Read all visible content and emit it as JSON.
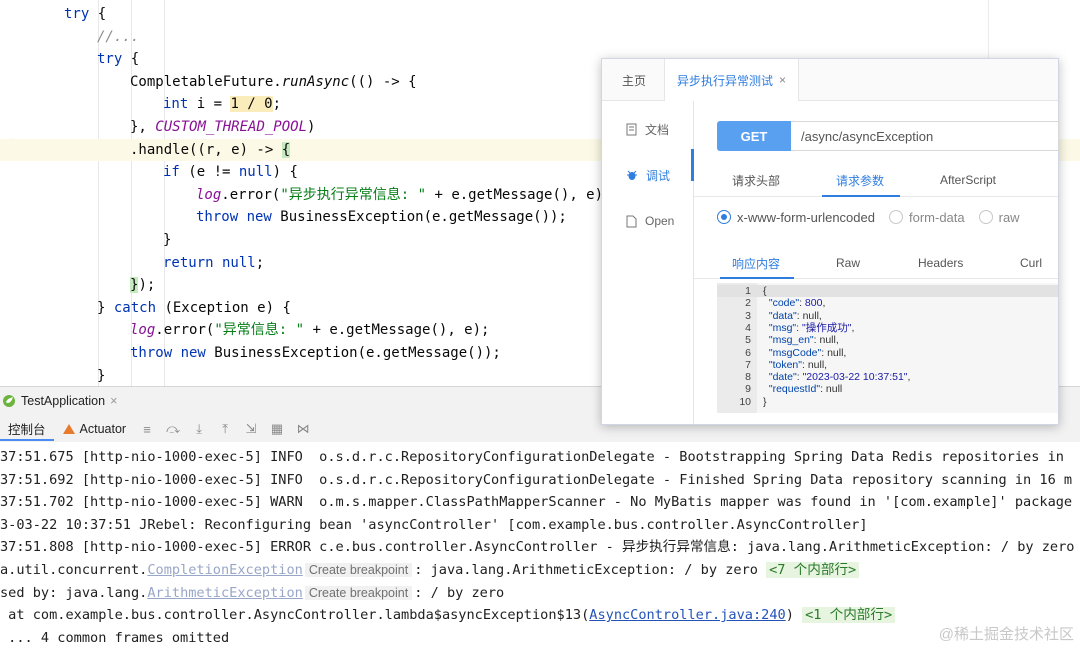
{
  "editor": {
    "lines": [
      {
        "ind": 0,
        "parts": [
          [
            "try",
            "kw"
          ],
          [
            " {",
            ""
          ]
        ]
      },
      {
        "ind": 1,
        "parts": [
          [
            "//...",
            "cm"
          ]
        ]
      },
      {
        "ind": 1,
        "parts": [
          [
            "try",
            "kw"
          ],
          [
            " {",
            ""
          ]
        ]
      },
      {
        "ind": 2,
        "parts": [
          [
            "CompletableFuture.",
            ""
          ],
          [
            "runAsync",
            "it"
          ],
          [
            "(() -> {",
            ""
          ]
        ]
      },
      {
        "ind": 3,
        "parts": [
          [
            "int",
            "kw"
          ],
          [
            " i = ",
            ""
          ],
          [
            "1 / 0",
            "bg1"
          ],
          [
            ";",
            ""
          ]
        ]
      },
      {
        "ind": 2,
        "parts": [
          [
            "}, ",
            ""
          ],
          [
            "CUSTOM_THREAD_POOL",
            "sf"
          ],
          [
            ")",
            ""
          ]
        ]
      },
      {
        "ind": 2,
        "hl": true,
        "parts": [
          [
            ".handle((r, e) -> ",
            ""
          ],
          [
            "{",
            "bbr"
          ]
        ]
      },
      {
        "ind": 3,
        "parts": [
          [
            "if",
            "kw"
          ],
          [
            " (e != ",
            ""
          ],
          [
            "null",
            "kw"
          ],
          [
            ") {",
            ""
          ]
        ]
      },
      {
        "ind": 4,
        "parts": [
          [
            "log",
            "lg"
          ],
          [
            ".error(",
            ""
          ],
          [
            "\"异步执行异常信息: \"",
            "st"
          ],
          [
            " + e.getMessage(), e);",
            ""
          ]
        ]
      },
      {
        "ind": 4,
        "parts": [
          [
            "throw new",
            "kw"
          ],
          [
            " BusinessException(e.getMessage());",
            ""
          ]
        ]
      },
      {
        "ind": 3,
        "parts": [
          [
            "}",
            ""
          ]
        ]
      },
      {
        "ind": 3,
        "parts": [
          [
            "return null",
            "kw"
          ],
          [
            ";",
            ""
          ]
        ]
      },
      {
        "ind": 2,
        "parts": [
          [
            "}",
            "bbr"
          ],
          [
            ");",
            ""
          ]
        ]
      },
      {
        "ind": 1,
        "parts": [
          [
            "} ",
            ""
          ],
          [
            "catch",
            "kw"
          ],
          [
            " (Exception e) {",
            ""
          ]
        ]
      },
      {
        "ind": 2,
        "parts": [
          [
            "log",
            "lg"
          ],
          [
            ".error(",
            ""
          ],
          [
            "\"异常信息: \"",
            "st"
          ],
          [
            " + e.getMessage(), e);",
            ""
          ]
        ]
      },
      {
        "ind": 2,
        "parts": [
          [
            "throw new",
            "kw"
          ],
          [
            " BusinessException(e.getMessage());",
            ""
          ]
        ]
      },
      {
        "ind": 1,
        "parts": [
          [
            "}",
            ""
          ]
        ]
      }
    ]
  },
  "run_tab": {
    "label": "TestApplication",
    "close": "×"
  },
  "toolbar": {
    "console_label": "控制台",
    "actuator_label": "Actuator"
  },
  "console": {
    "lines": [
      [
        [
          "37:51.675 [http-nio-1000-exec-5] INFO  o.s.d.r.c.RepositoryConfigurationDelegate - Bootstrapping Spring Data Redis repositories in",
          ""
        ]
      ],
      [
        [
          "37:51.692 [http-nio-1000-exec-5] INFO  o.s.d.r.c.RepositoryConfigurationDelegate - Finished Spring Data repository scanning in 16 m",
          ""
        ]
      ],
      [
        [
          "37:51.702 [http-nio-1000-exec-5] WARN  o.m.s.mapper.ClassPathMapperScanner - No MyBatis mapper was found in '[com.example]' package",
          ""
        ]
      ],
      [
        [
          "3-03-22 10:37:51 JRebel: Reconfiguring bean 'asyncController' [com.example.bus.controller.AsyncController]",
          ""
        ]
      ],
      [
        [
          "37:51.808 [http-nio-1000-exec-5] ERROR c.e.bus.controller.AsyncController - 异步执行异常信息: java.lang.ArithmeticException: / by zero",
          "err"
        ]
      ],
      [
        [
          "a.util.concurrent.",
          ""
        ],
        [
          "CompletionException",
          "glink"
        ],
        [
          "Create breakpoint",
          "cb"
        ],
        [
          ": java.lang.ArithmeticException: / by zero ",
          ""
        ],
        [
          "<7 个内部行>",
          "inner"
        ]
      ],
      [
        [
          "sed by: java.lang.",
          ""
        ],
        [
          "ArithmeticException",
          "glink"
        ],
        [
          "Create breakpoint",
          "cb"
        ],
        [
          ": / by zero",
          ""
        ]
      ],
      [
        [
          " at com.example.bus.controller.AsyncController.lambda$asyncException$13(",
          ""
        ],
        [
          "AsyncController.java:240",
          "link"
        ],
        [
          ") ",
          ""
        ],
        [
          "<1 个内部行>",
          "inner"
        ]
      ],
      [
        [
          " ... 4 common frames omitted",
          ""
        ]
      ]
    ],
    "watermark": "@稀土掘金技术社区"
  },
  "api_panel": {
    "tabs": {
      "home": "主页",
      "active": "异步执行异常测试",
      "close": "×"
    },
    "side": {
      "doc": "文档",
      "debug": "调试",
      "open": "Open"
    },
    "method": "GET",
    "url": "/async/asyncException",
    "req_tabs": {
      "headers": "请求头部",
      "params": "请求参数",
      "after": "AfterScript"
    },
    "radios": {
      "urlenc": "x-www-form-urlencoded",
      "formdata": "form-data",
      "raw": "raw"
    },
    "resp_tabs": {
      "content": "响应内容",
      "raw": "Raw",
      "headers": "Headers",
      "curl": "Curl"
    },
    "json_lines": [
      {
        "n": "1",
        "t": [
          [
            "{",
            ""
          ]
        ]
      },
      {
        "n": "2",
        "t": [
          [
            "  ",
            ""
          ],
          [
            "\"code\"",
            "jk"
          ],
          [
            ": ",
            ""
          ],
          [
            "800",
            "jn"
          ],
          [
            ",",
            ""
          ]
        ]
      },
      {
        "n": "3",
        "t": [
          [
            "  ",
            ""
          ],
          [
            "\"data\"",
            "jk"
          ],
          [
            ": null,",
            ""
          ]
        ]
      },
      {
        "n": "4",
        "t": [
          [
            "  ",
            ""
          ],
          [
            "\"msg\"",
            "jk"
          ],
          [
            ": ",
            ""
          ],
          [
            "\"操作成功\"",
            "js"
          ],
          [
            ",",
            ""
          ]
        ]
      },
      {
        "n": "5",
        "t": [
          [
            "  ",
            ""
          ],
          [
            "\"msg_en\"",
            "jk"
          ],
          [
            ": null,",
            ""
          ]
        ]
      },
      {
        "n": "6",
        "t": [
          [
            "  ",
            ""
          ],
          [
            "\"msgCode\"",
            "jk"
          ],
          [
            ": null,",
            ""
          ]
        ]
      },
      {
        "n": "7",
        "t": [
          [
            "  ",
            ""
          ],
          [
            "\"token\"",
            "jk"
          ],
          [
            ": null,",
            ""
          ]
        ]
      },
      {
        "n": "8",
        "t": [
          [
            "  ",
            ""
          ],
          [
            "\"date\"",
            "jk"
          ],
          [
            ": ",
            ""
          ],
          [
            "\"2023-03-22 10:37:51\"",
            "js"
          ],
          [
            ",",
            ""
          ]
        ]
      },
      {
        "n": "9",
        "t": [
          [
            "  ",
            ""
          ],
          [
            "\"requestId\"",
            "jk"
          ],
          [
            ": null",
            ""
          ]
        ]
      },
      {
        "n": "10",
        "t": [
          [
            "}",
            ""
          ]
        ]
      }
    ]
  }
}
